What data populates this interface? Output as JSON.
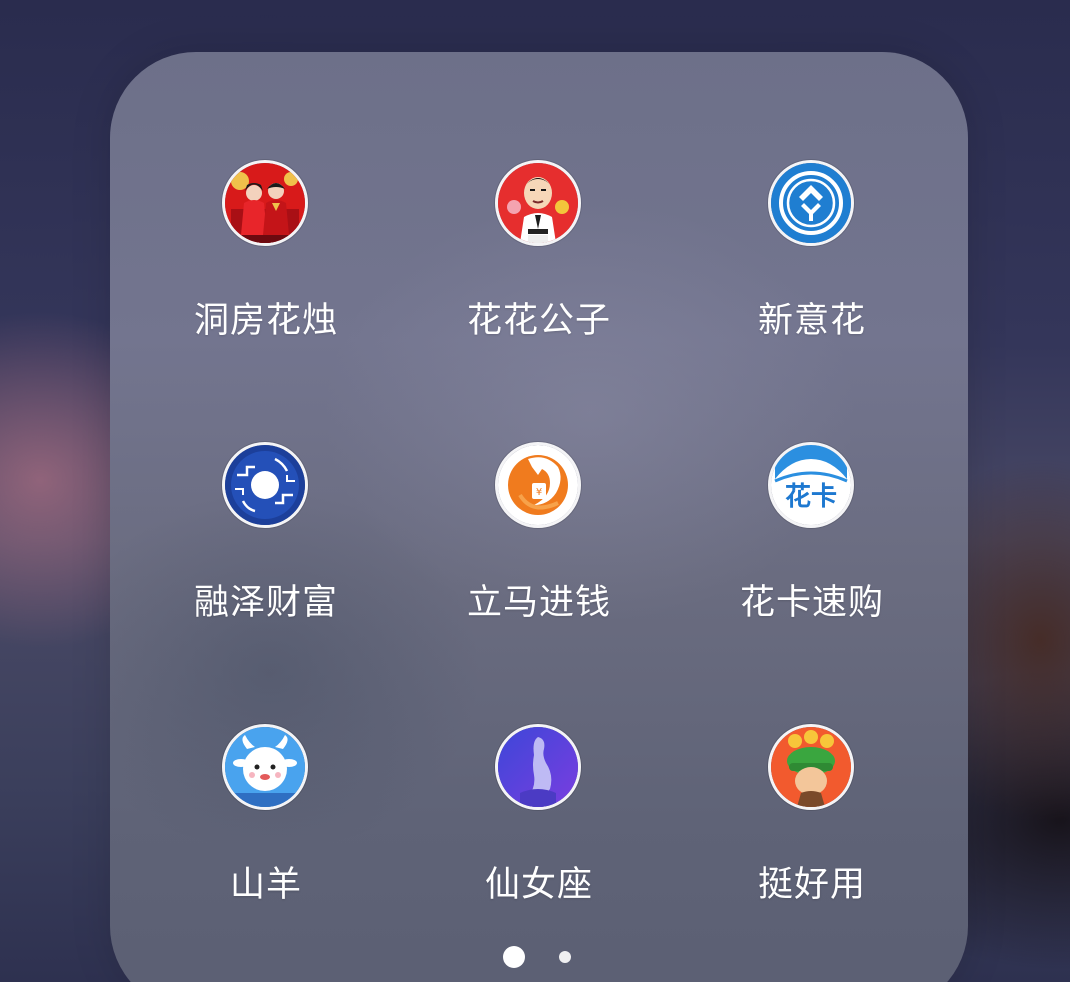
{
  "folder": {
    "apps": [
      {
        "label": "洞房花烛",
        "icon": "wedding-couple-icon"
      },
      {
        "label": "花花公子",
        "icon": "cartoon-gentleman-icon"
      },
      {
        "label": "新意花",
        "icon": "blue-shield-logo-icon"
      },
      {
        "label": "融泽财富",
        "icon": "blue-jade-disc-icon"
      },
      {
        "label": "立马进钱",
        "icon": "orange-horse-yuan-icon"
      },
      {
        "label": "花卡速购",
        "icon": "huaka-text-logo-icon"
      },
      {
        "label": "山羊",
        "icon": "white-goat-icon"
      },
      {
        "label": "仙女座",
        "icon": "purple-fairy-icon"
      },
      {
        "label": "挺好用",
        "icon": "green-cap-mascot-icon"
      }
    ],
    "icon_texts": {
      "huaka": "花卡",
      "yuan": "¥"
    }
  },
  "pager": {
    "pages": 2,
    "current": 1
  },
  "colors": {
    "label": "#ffffff",
    "icon_border": "#f4f4f6",
    "folder_bg": "#6d7089"
  }
}
